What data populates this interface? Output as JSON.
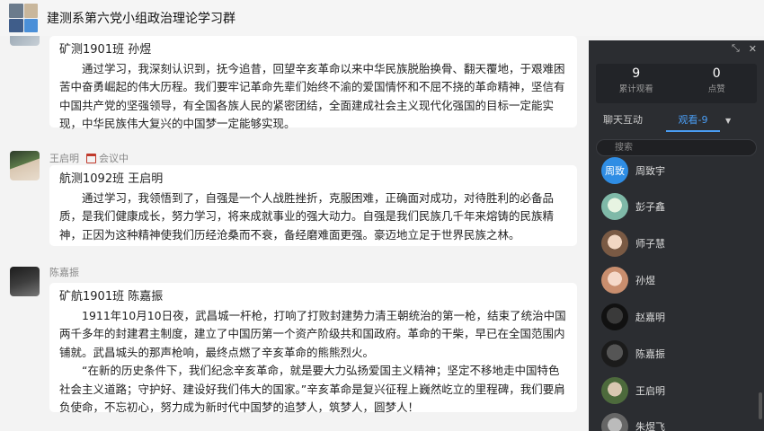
{
  "header": {
    "title": "建测系第六党小组政治理论学习群"
  },
  "messages": [
    {
      "sender": "",
      "title": "矿测1901班  孙煜",
      "body": [
        "通过学习，我深刻认识到，抚今追昔，回望辛亥革命以来中华民族脱胎换骨、翻天覆地，于艰难困苦中奋勇崛起的伟大历程。我们要牢记革命先辈们始终不渝的爱国情怀和不屈不挠的革命精神，坚信有中国共产党的坚强领导，有全国各族人民的紧密团结，全面建成社会主义现代化强国的目标一定能实现，中华民族伟大复兴的中国梦一定能够实现。"
      ]
    },
    {
      "sender": "王启明",
      "status": "会议中",
      "title": "航测1092班  王启明",
      "body": [
        "通过学习，我领悟到了，自强是一个人战胜挫折，克服困难，正确面对成功，对待胜利的必备品质，是我们健康成长，努力学习，将来成就事业的强大动力。自强是我们民族几千年来熔铸的民族精神，正因为这种精神使我们历经沧桑而不衰，备经磨难面更强。豪迈地立足于世界民族之林。"
      ]
    },
    {
      "sender": "陈嘉振",
      "title": "矿航1901班  陈嘉振",
      "body": [
        "1911年10月10日夜，武昌城一杆枪，打响了打败封建势力清王朝统治的第一枪，结束了统治中国两千多年的封建君主制度，建立了中国历第一个资产阶级共和国政府。革命的干柴，早已在全国范围内铺就。武昌城头的那声枪响，最终点燃了辛亥革命的熊熊烈火。",
        "“在新的历史条件下，我们纪念辛亥革命，就是要大力弘扬爱国主义精神；坚定不移地走中国特色社会主义道路；守护好、建设好我们伟大的国家。”辛亥革命是复兴征程上巍然屹立的里程碑，我们要肩负使命，不忘初心，努力成为新时代中国梦的追梦人，筑梦人，圆梦人！"
      ]
    }
  ],
  "panel": {
    "top_icons": [
      "shrink-icon",
      "close-icon"
    ],
    "stats": [
      {
        "value": "9",
        "label": "累计观看"
      },
      {
        "value": "0",
        "label": "点赞"
      }
    ],
    "tabs": {
      "chat": "聊天互动",
      "viewers": "观看-9"
    },
    "search_placeholder": "搜索",
    "members": [
      {
        "name": "周致宇",
        "avatar_text": "周致"
      },
      {
        "name": "彭子鑫"
      },
      {
        "name": "师子慧"
      },
      {
        "name": "孙煜"
      },
      {
        "name": "赵嘉明"
      },
      {
        "name": "陈嘉振"
      },
      {
        "name": "王启明"
      },
      {
        "name": "朱煜飞"
      }
    ]
  },
  "colors": {
    "accent": "#4a9df3",
    "panel_bg": "#2b2d31",
    "chat_bg": "#f3f3f3"
  }
}
